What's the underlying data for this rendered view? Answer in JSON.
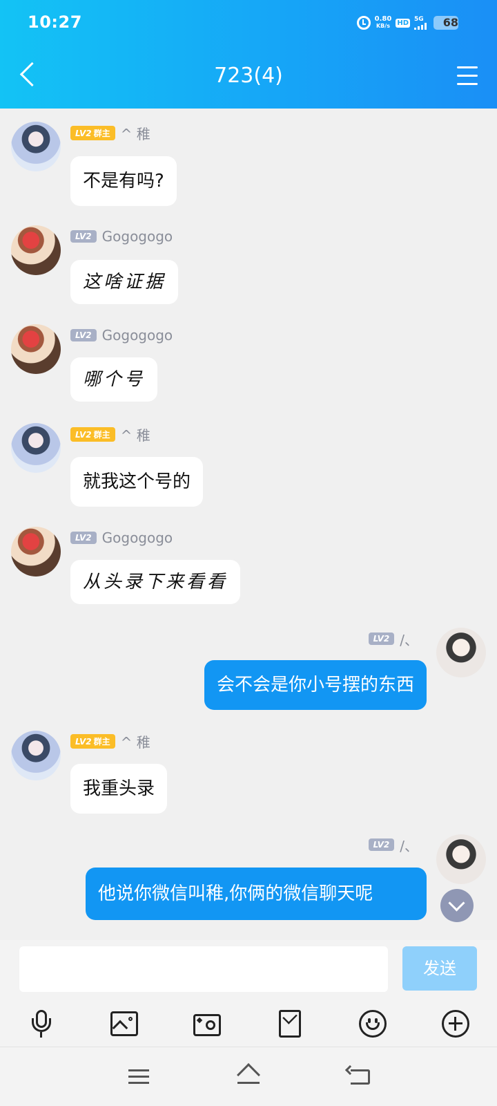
{
  "status_bar": {
    "time": "10:27",
    "net_speed": "0.80",
    "net_unit": "KB/s",
    "hd_label": "HD",
    "signal_label": "5G",
    "battery": "68"
  },
  "header": {
    "title": "723(4)"
  },
  "messages": [
    {
      "side": "in",
      "avatar": "avatar-girl",
      "level": "LV2",
      "role": "群主",
      "name": "^ 稚",
      "text": "不是有吗?"
    },
    {
      "side": "in",
      "avatar": "avatar-red",
      "level": "LV2",
      "role": "",
      "name": "Gogogogo",
      "text": "这啥证据"
    },
    {
      "side": "in",
      "avatar": "avatar-red",
      "level": "LV2",
      "role": "",
      "name": "Gogogogo",
      "text": "哪个号"
    },
    {
      "side": "in",
      "avatar": "avatar-girl",
      "level": "LV2",
      "role": "群主",
      "name": "^ 稚",
      "text": "就我这个号的"
    },
    {
      "side": "in",
      "avatar": "avatar-red",
      "level": "LV2",
      "role": "",
      "name": "Gogogogo",
      "text": "从头录下来看看"
    },
    {
      "side": "out",
      "avatar": "avatar-boy",
      "level": "LV2",
      "role": "",
      "name": "/、",
      "text": "会不会是你小号摆的东西"
    },
    {
      "side": "in",
      "avatar": "avatar-girl",
      "level": "LV2",
      "role": "群主",
      "name": "^ 稚",
      "text": "我重头录"
    },
    {
      "side": "out",
      "avatar": "avatar-boy",
      "level": "LV2",
      "role": "",
      "name": "/、",
      "text": "他说你微信叫稚,你俩的微信聊天呢"
    }
  ],
  "composer": {
    "input_value": "",
    "send_label": "发送"
  },
  "toolbar": {
    "icons": [
      "microphone-icon",
      "image-icon",
      "camera-icon",
      "red-envelope-icon",
      "emoji-icon",
      "plus-icon"
    ]
  },
  "colors": {
    "header_start": "#13c3f5",
    "header_end": "#1a8ff6",
    "outgoing_bubble": "#1296f3",
    "owner_badge": "#fbbd27",
    "level_badge": "#a8b0c6",
    "send_button_disabled": "#8fd0fb"
  }
}
